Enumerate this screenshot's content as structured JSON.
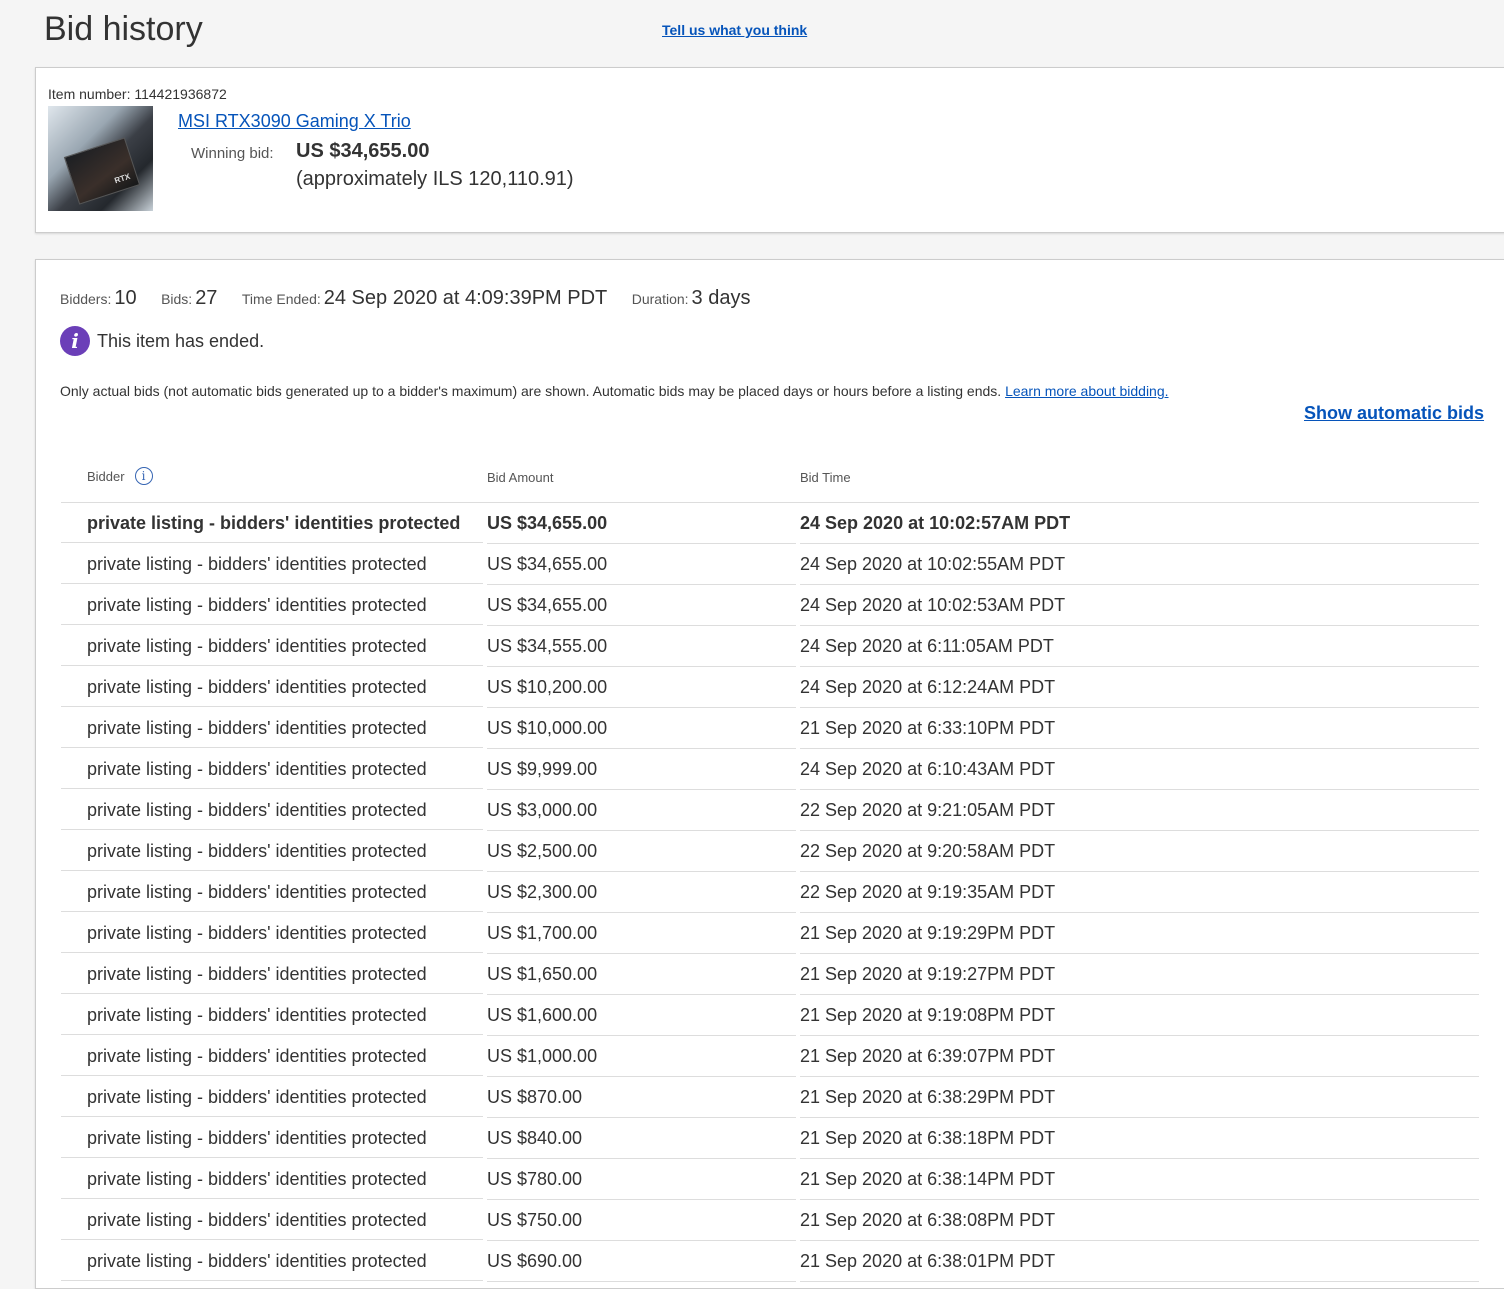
{
  "page": {
    "title": "Bid history",
    "feedback_link": "Tell us what you think"
  },
  "item": {
    "number_label": "Item number: 114421936872",
    "thumbnail_text": "RTX",
    "title": "MSI RTX3090 Gaming X Trio",
    "winning_label": "Winning bid:",
    "winning_amount": "US $34,655.00",
    "winning_approx": "(approximately ILS 120,110.91)"
  },
  "summary": {
    "bidders_label": "Bidders:",
    "bidders_value": "10",
    "bids_label": "Bids:",
    "bids_value": "27",
    "time_ended_label": "Time Ended:",
    "time_ended_value": "24 Sep 2020 at 4:09:39PM PDT",
    "duration_label": "Duration:",
    "duration_value": "3 days"
  },
  "status": {
    "info_icon": "i",
    "ended_text": "This item has ended."
  },
  "notice": {
    "text": "Only actual bids (not automatic bids generated up to a bidder's maximum) are shown. Automatic bids may be placed days or hours before a listing ends. ",
    "link": "Learn more about bidding."
  },
  "show_automatic_bids": "Show automatic bids",
  "table": {
    "headers": {
      "bidder": "Bidder",
      "bidder_info_icon": "i",
      "amount": "Bid Amount",
      "time": "Bid Time"
    },
    "rows": [
      {
        "bidder": "private listing - bidders' identities protected",
        "amount": "US $34,655.00",
        "time": "24 Sep 2020 at 10:02:57AM PDT"
      },
      {
        "bidder": "private listing - bidders' identities protected",
        "amount": "US $34,655.00",
        "time": "24 Sep 2020 at 10:02:55AM PDT"
      },
      {
        "bidder": "private listing - bidders' identities protected",
        "amount": "US $34,655.00",
        "time": "24 Sep 2020 at 10:02:53AM PDT"
      },
      {
        "bidder": "private listing - bidders' identities protected",
        "amount": "US $34,555.00",
        "time": "24 Sep 2020 at 6:11:05AM PDT"
      },
      {
        "bidder": "private listing - bidders' identities protected",
        "amount": "US $10,200.00",
        "time": "24 Sep 2020 at 6:12:24AM PDT"
      },
      {
        "bidder": "private listing - bidders' identities protected",
        "amount": "US $10,000.00",
        "time": "21 Sep 2020 at 6:33:10PM PDT"
      },
      {
        "bidder": "private listing - bidders' identities protected",
        "amount": "US $9,999.00",
        "time": "24 Sep 2020 at 6:10:43AM PDT"
      },
      {
        "bidder": "private listing - bidders' identities protected",
        "amount": "US $3,000.00",
        "time": "22 Sep 2020 at 9:21:05AM PDT"
      },
      {
        "bidder": "private listing - bidders' identities protected",
        "amount": "US $2,500.00",
        "time": "22 Sep 2020 at 9:20:58AM PDT"
      },
      {
        "bidder": "private listing - bidders' identities protected",
        "amount": "US $2,300.00",
        "time": "22 Sep 2020 at 9:19:35AM PDT"
      },
      {
        "bidder": "private listing - bidders' identities protected",
        "amount": "US $1,700.00",
        "time": "21 Sep 2020 at 9:19:29PM PDT"
      },
      {
        "bidder": "private listing - bidders' identities protected",
        "amount": "US $1,650.00",
        "time": "21 Sep 2020 at 9:19:27PM PDT"
      },
      {
        "bidder": "private listing - bidders' identities protected",
        "amount": "US $1,600.00",
        "time": "21 Sep 2020 at 9:19:08PM PDT"
      },
      {
        "bidder": "private listing - bidders' identities protected",
        "amount": "US $1,000.00",
        "time": "21 Sep 2020 at 6:39:07PM PDT"
      },
      {
        "bidder": "private listing - bidders' identities protected",
        "amount": "US $870.00",
        "time": "21 Sep 2020 at 6:38:29PM PDT"
      },
      {
        "bidder": "private listing - bidders' identities protected",
        "amount": "US $840.00",
        "time": "21 Sep 2020 at 6:38:18PM PDT"
      },
      {
        "bidder": "private listing - bidders' identities protected",
        "amount": "US $780.00",
        "time": "21 Sep 2020 at 6:38:14PM PDT"
      },
      {
        "bidder": "private listing - bidders' identities protected",
        "amount": "US $750.00",
        "time": "21 Sep 2020 at 6:38:08PM PDT"
      },
      {
        "bidder": "private listing - bidders' identities protected",
        "amount": "US $690.00",
        "time": "21 Sep 2020 at 6:38:01PM PDT"
      }
    ]
  }
}
